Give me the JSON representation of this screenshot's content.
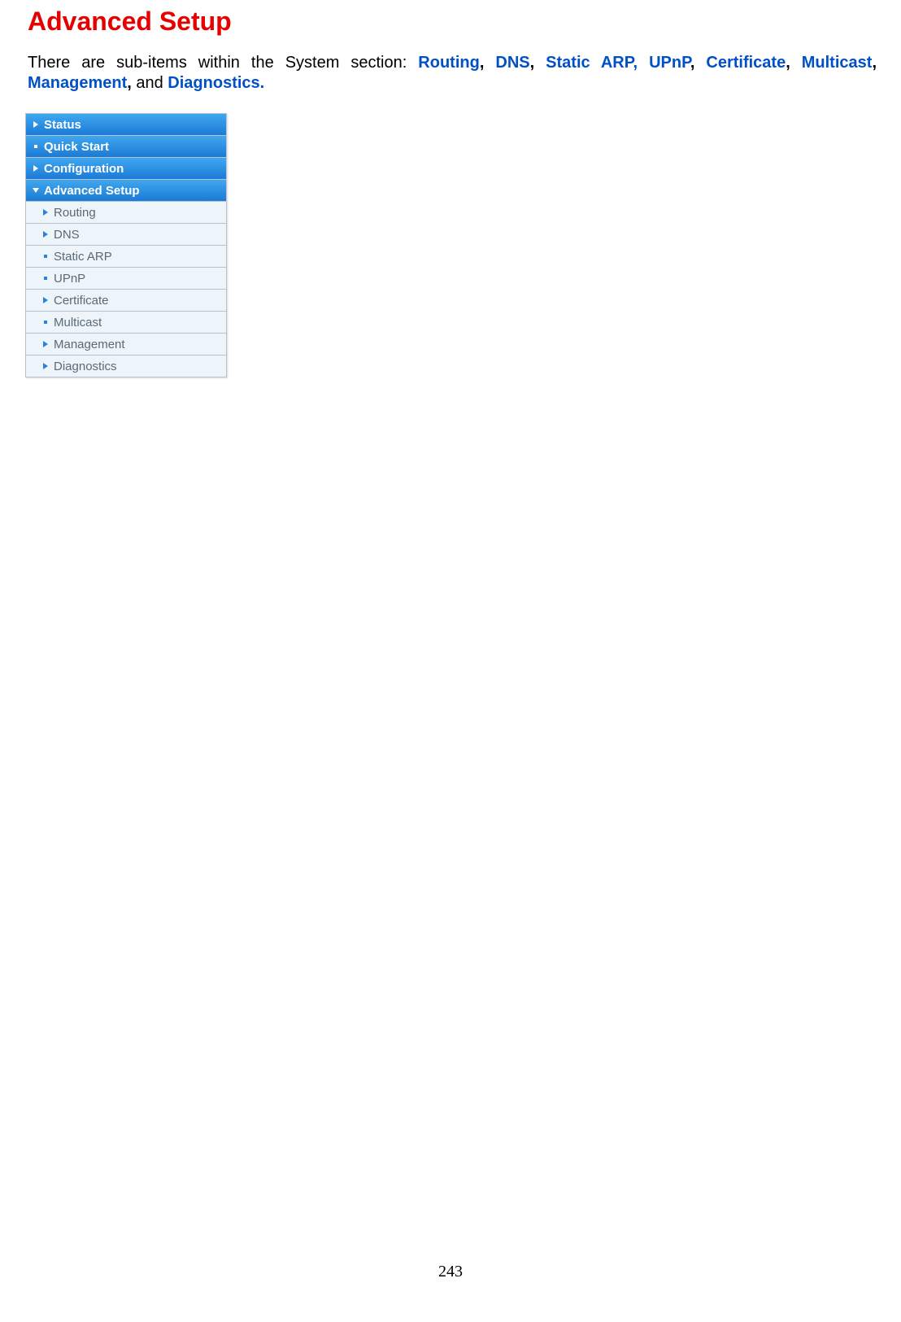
{
  "heading": "Advanced Setup",
  "intro": {
    "prefix": "There are sub-items within the System section: ",
    "links": [
      "Routing",
      "DNS",
      "Static ARP,",
      "UPnP",
      "Certificate",
      "Multicast",
      "Management"
    ],
    "and": " and ",
    "last": "Diagnostics.",
    "comma": ", "
  },
  "nav": {
    "top": [
      {
        "label": "Status",
        "icon": "chev-right"
      },
      {
        "label": "Quick Start",
        "icon": "dot"
      },
      {
        "label": "Configuration",
        "icon": "chev-right"
      },
      {
        "label": "Advanced Setup",
        "icon": "chev-down"
      }
    ],
    "sub": [
      {
        "label": "Routing",
        "icon": "chev-right"
      },
      {
        "label": "DNS",
        "icon": "chev-right"
      },
      {
        "label": "Static ARP",
        "icon": "dot"
      },
      {
        "label": "UPnP",
        "icon": "dot"
      },
      {
        "label": "Certificate",
        "icon": "chev-right"
      },
      {
        "label": "Multicast",
        "icon": "dot"
      },
      {
        "label": "Management",
        "icon": "chev-right"
      },
      {
        "label": "Diagnostics",
        "icon": "chev-right"
      }
    ]
  },
  "page_number": "243"
}
